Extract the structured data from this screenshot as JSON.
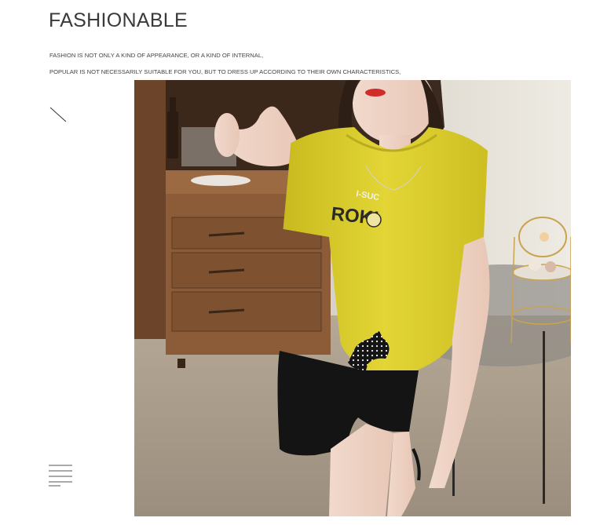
{
  "header": {
    "title": "FASHIONABLE",
    "lines": [
      "FASHION IS NOT ONLY A KIND OF APPEARANCE, OR A KIND OF INTERNAL,",
      "POPULAR IS NOT NECESSARILY SUITABLE FOR YOU, BUT TO DRESS UP ACCORDING TO THEIR OWN CHARACTERISTICS,"
    ]
  },
  "decor": {
    "slash_icon": "diagonal-line-icon",
    "menu_icon": "text-lines-icon"
  },
  "photo": {
    "description_icon": "model-photo",
    "shirt_print": "ROK!",
    "necklace_text": "I-SUC",
    "colors": {
      "shirt": "#d9cc2b",
      "shorts": "#141414",
      "cabinet": "#8b5a36",
      "floor": "#a89a8a",
      "wall": "#e8e4dc"
    }
  }
}
